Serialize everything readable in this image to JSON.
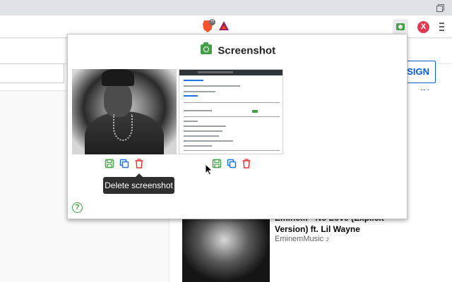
{
  "browser": {
    "toolbar_icons": [
      "window-restore-icon",
      "brave-shields-icon",
      "brave-rewards-icon",
      "screenshot-extension-icon",
      "extension-x-icon",
      "menu-icon"
    ],
    "brave_badge": "75",
    "extension_x_letter": "X"
  },
  "page": {
    "signin_label": "SIGN IN",
    "videos": [
      {
        "title": "",
        "channel": ""
      },
      {
        "title": "Eminem - No Love (Explicit Version) ft. Lil Wayne",
        "channel": "EminemMusic ♪"
      }
    ]
  },
  "popup": {
    "title": "Screenshot",
    "title_icon": "camera-icon",
    "screenshots": [
      {
        "thumbnail": "portrait-photo",
        "actions": [
          "save-icon",
          "copy-icon",
          "delete-icon"
        ]
      },
      {
        "thumbnail": "webpage-capture",
        "actions": [
          "save-icon",
          "copy-icon",
          "delete-icon"
        ]
      }
    ],
    "tooltip": "Delete screenshot",
    "help_icon": "help-icon"
  },
  "colors": {
    "accent_green": "#43a047",
    "copy_blue": "#1a73e8",
    "delete_red": "#e53935",
    "signin_blue": "#065fd4"
  }
}
